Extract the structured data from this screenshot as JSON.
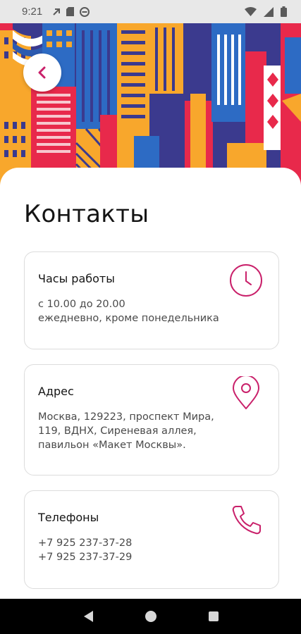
{
  "status_bar": {
    "time": "9:21",
    "left_icons": [
      "notification-icon",
      "sd-card-icon",
      "do-not-disturb-icon"
    ],
    "right_icons": [
      "wifi-icon",
      "signal-icon",
      "battery-icon"
    ]
  },
  "header": {
    "back_icon": "chevron-left-icon",
    "accent_color": "#c9206a"
  },
  "page": {
    "title": "Контакты"
  },
  "cards": {
    "hours": {
      "title": "Часы работы",
      "lines": [
        "с 10.00 до 20.00",
        "ежедневно, кроме понедельника"
      ],
      "icon": "clock-icon"
    },
    "address": {
      "title": "Адрес",
      "lines": [
        "Москва, 129223, проспект Мира,",
        "119, ВДНХ, Сиреневая аллея,",
        "павильон «Макет Москвы»."
      ],
      "icon": "location-pin-icon"
    },
    "phones": {
      "title": "Телефоны",
      "lines": [
        "+7 925 237-37-28",
        "+7 925 237-37-29"
      ],
      "icon": "phone-icon"
    }
  },
  "nav_bar": {
    "buttons": [
      "back-triangle-icon",
      "home-circle-icon",
      "recents-square-icon"
    ]
  }
}
